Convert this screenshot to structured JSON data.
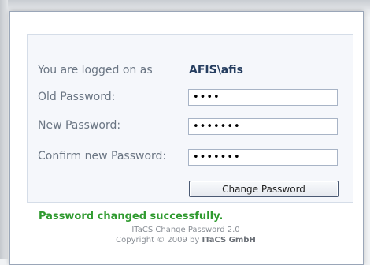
{
  "login": {
    "prefix": "You are logged on as",
    "user": "AFIS\\afis"
  },
  "form": {
    "old_password_label": "Old Password:",
    "old_password_value": "••••",
    "new_password_label": "New Password:",
    "new_password_value": "•••••••",
    "confirm_password_label": "Confirm new Password:",
    "confirm_password_value": "•••••••",
    "submit_label": "Change Password"
  },
  "status": {
    "message": "Password changed successfully.",
    "color": "#2f9a2f"
  },
  "footer": {
    "product": "ITaCS Change Password 2.0",
    "copyright": "Copyright © 2009 by",
    "company": "ITaCS GmbH"
  }
}
